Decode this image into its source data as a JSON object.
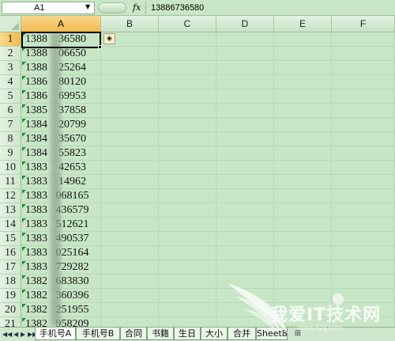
{
  "formula_bar": {
    "name_box": "A1",
    "fx_label": "fx",
    "formula_value": "13886736580"
  },
  "columns": [
    "A",
    "B",
    "C",
    "D",
    "E",
    "F"
  ],
  "rows": [
    {
      "num": "1",
      "value": "1388    36580"
    },
    {
      "num": "2",
      "value": "1388    06650"
    },
    {
      "num": "3",
      "value": "1388    25264"
    },
    {
      "num": "4",
      "value": "1386    80120"
    },
    {
      "num": "5",
      "value": "1386    69953"
    },
    {
      "num": "6",
      "value": "1385    37858"
    },
    {
      "num": "7",
      "value": "1384    20799"
    },
    {
      "num": "8",
      "value": "1384    35670"
    },
    {
      "num": "9",
      "value": "1384    55823"
    },
    {
      "num": "10",
      "value": "1383    42653"
    },
    {
      "num": "11",
      "value": "1383    14962"
    },
    {
      "num": "12",
      "value": "1383   068165"
    },
    {
      "num": "13",
      "value": "1383   436579"
    },
    {
      "num": "14",
      "value": "1383   512621"
    },
    {
      "num": "15",
      "value": "1383   490537"
    },
    {
      "num": "16",
      "value": "1383   025164"
    },
    {
      "num": "17",
      "value": "1383   729282"
    },
    {
      "num": "18",
      "value": "1382   683830"
    },
    {
      "num": "19",
      "value": "1382   360396"
    },
    {
      "num": "20",
      "value": "1382   251955"
    },
    {
      "num": "21",
      "value": "1382   958209"
    }
  ],
  "smart_tag_glyph": "◈",
  "sheet_tabs": [
    "手机号A",
    "手机号B",
    "合同",
    "书籍",
    "生日",
    "大小",
    "合并",
    "Sheet8"
  ],
  "nav_glyphs": [
    "◀◀",
    "◀",
    "▶",
    "▶▶"
  ],
  "add_tab_glyph": "⊞",
  "watermark": {
    "text": "我爱IT技术网",
    "url": "www.52ij.com"
  },
  "colors": {
    "active_header": "#f1b94e",
    "grid": "#c7e6c6",
    "error_triangle": "#1f8a2d"
  }
}
